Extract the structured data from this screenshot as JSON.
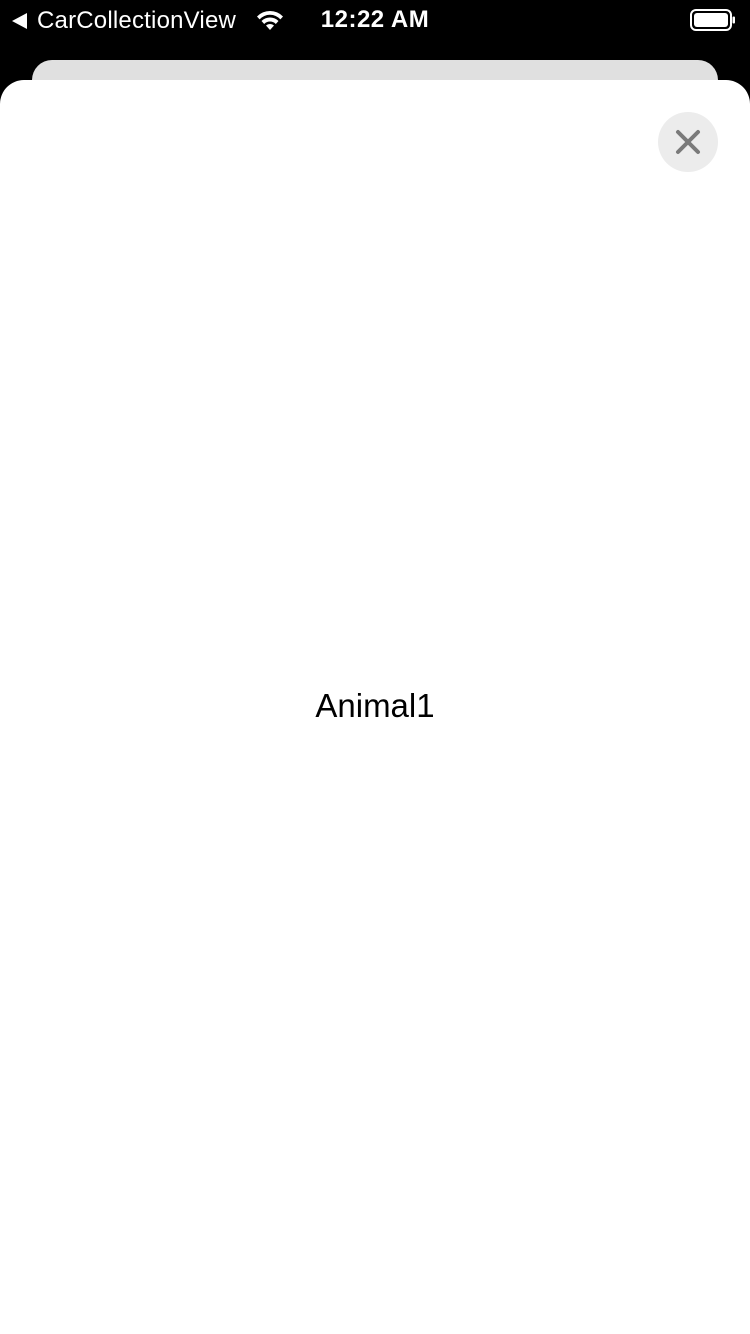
{
  "status_bar": {
    "back_label": "CarCollectionView",
    "time": "12:22 AM",
    "icons": [
      "back-arrow-icon",
      "wifi-icon",
      "battery-icon"
    ]
  },
  "modal": {
    "close_icon": "close-icon",
    "title": "Animal1"
  },
  "colors": {
    "status_bar_bg": "#000000",
    "sheet_bg": "#ffffff",
    "back_sheet_bg": "#e0e0e0",
    "close_button_bg": "#ececec",
    "close_icon_color": "#7a7a7a"
  }
}
